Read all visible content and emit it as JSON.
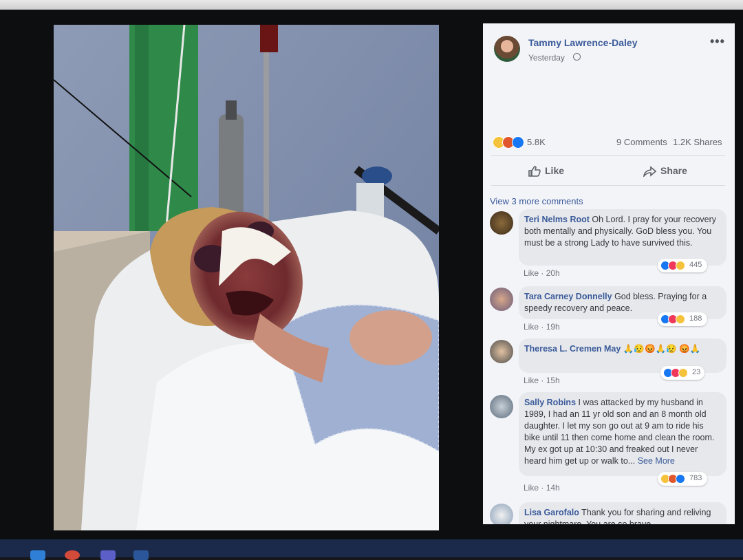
{
  "post": {
    "author": "Tammy Lawrence-Daley",
    "time": "Yesterday",
    "reaction_count": "5.8K",
    "comments": "9 Comments",
    "shares": "1.2K Shares",
    "like_label": "Like",
    "share_label": "Share"
  },
  "view_more": "View 3 more comments",
  "colors": {
    "link": "#3a5a99",
    "panel_bg": "#f3f4f8",
    "bubble_bg": "#e6e8ec"
  },
  "comments": [
    {
      "name": "Teri Nelms Root",
      "text": "Oh Lord. I pray for your recovery both mentally and physically. GoD bless you. You must be a strong Lady to have survived this.",
      "like": "Like",
      "age": "20h",
      "count": "445"
    },
    {
      "name": "Tara Carney Donnelly",
      "text": "God bless. Praying for a speedy recovery and peace.",
      "like": "Like",
      "age": "19h",
      "count": "188"
    },
    {
      "name": "Theresa L. Cremen May",
      "text": "🙏😥😡🙏😥 😡🙏",
      "like": "Like",
      "age": "15h",
      "count": "23"
    },
    {
      "name": "Sally Robins",
      "text": "I was attacked by my husband in 1989, I had an 11 yr old son and an 8 month old daughter. I let my son go out at 9 am to ride his bike until 11 then come home and clean the room. My ex got up at 10:30 and freaked out I never heard him get up or walk to...",
      "see_more": "See More",
      "like": "Like",
      "age": "14h",
      "count": "783"
    },
    {
      "name": "Lisa Garofalo",
      "text": "Thank you for sharing and reliving your nightmare. You are so brave."
    }
  ]
}
